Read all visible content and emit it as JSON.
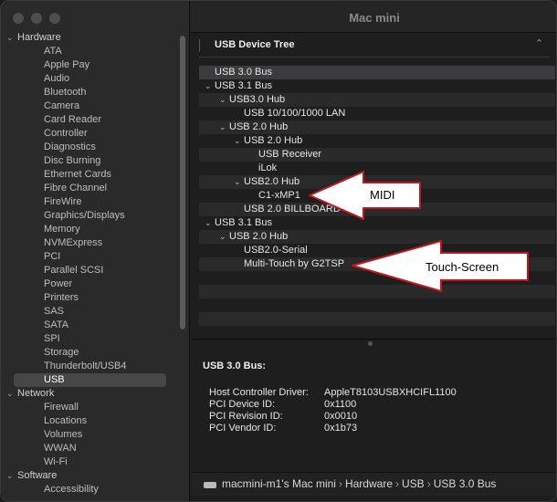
{
  "window": {
    "title": "Mac mini"
  },
  "sidebar": {
    "rows": [
      {
        "kind": "group",
        "label": "Hardware"
      },
      {
        "kind": "item",
        "label": "ATA"
      },
      {
        "kind": "item",
        "label": "Apple Pay"
      },
      {
        "kind": "item",
        "label": "Audio"
      },
      {
        "kind": "item",
        "label": "Bluetooth"
      },
      {
        "kind": "item",
        "label": "Camera"
      },
      {
        "kind": "item",
        "label": "Card Reader"
      },
      {
        "kind": "item",
        "label": "Controller"
      },
      {
        "kind": "item",
        "label": "Diagnostics"
      },
      {
        "kind": "item",
        "label": "Disc Burning"
      },
      {
        "kind": "item",
        "label": "Ethernet Cards"
      },
      {
        "kind": "item",
        "label": "Fibre Channel"
      },
      {
        "kind": "item",
        "label": "FireWire"
      },
      {
        "kind": "item",
        "label": "Graphics/Displays"
      },
      {
        "kind": "item",
        "label": "Memory"
      },
      {
        "kind": "item",
        "label": "NVMExpress"
      },
      {
        "kind": "item",
        "label": "PCI"
      },
      {
        "kind": "item",
        "label": "Parallel SCSI"
      },
      {
        "kind": "item",
        "label": "Power"
      },
      {
        "kind": "item",
        "label": "Printers"
      },
      {
        "kind": "item",
        "label": "SAS"
      },
      {
        "kind": "item",
        "label": "SATA"
      },
      {
        "kind": "item",
        "label": "SPI"
      },
      {
        "kind": "item",
        "label": "Storage"
      },
      {
        "kind": "item",
        "label": "Thunderbolt/USB4"
      },
      {
        "kind": "item",
        "label": "USB",
        "selected": true
      },
      {
        "kind": "group",
        "label": "Network"
      },
      {
        "kind": "item",
        "label": "Firewall"
      },
      {
        "kind": "item",
        "label": "Locations"
      },
      {
        "kind": "item",
        "label": "Volumes"
      },
      {
        "kind": "item",
        "label": "WWAN"
      },
      {
        "kind": "item",
        "label": "Wi-Fi"
      },
      {
        "kind": "group",
        "label": "Software"
      },
      {
        "kind": "item",
        "label": "Accessibility"
      }
    ]
  },
  "tree": {
    "header": "USB Device Tree",
    "rows": [
      {
        "label": "USB 3.0 Bus",
        "level": 0,
        "expandable": false,
        "selected": true
      },
      {
        "label": "USB 3.1 Bus",
        "level": 0,
        "expandable": true
      },
      {
        "label": "USB3.0 Hub",
        "level": 1,
        "expandable": true
      },
      {
        "label": "USB 10/100/1000 LAN",
        "level": 2,
        "expandable": false
      },
      {
        "label": "USB 2.0 Hub",
        "level": 1,
        "expandable": true
      },
      {
        "label": "USB 2.0 Hub",
        "level": 2,
        "expandable": true
      },
      {
        "label": "USB Receiver",
        "level": 3,
        "expandable": false
      },
      {
        "label": "iLok",
        "level": 3,
        "expandable": false
      },
      {
        "label": "USB2.0 Hub",
        "level": 2,
        "expandable": true
      },
      {
        "label": "C1-xMP1",
        "level": 3,
        "expandable": false
      },
      {
        "label": "USB 2.0 BILLBOARD",
        "level": 2,
        "expandable": false
      },
      {
        "label": "USB 3.1 Bus",
        "level": 0,
        "expandable": true
      },
      {
        "label": "USB 2.0 Hub",
        "level": 1,
        "expandable": true
      },
      {
        "label": "USB2.0-Serial",
        "level": 2,
        "expandable": false
      },
      {
        "label": "Multi-Touch by G2TSP",
        "level": 2,
        "expandable": false
      },
      {
        "label": "",
        "level": 0
      },
      {
        "label": "",
        "level": 0
      },
      {
        "label": "",
        "level": 0
      },
      {
        "label": "",
        "level": 0
      },
      {
        "label": "",
        "level": 0
      }
    ]
  },
  "details": {
    "title": "USB 3.0 Bus:",
    "fields": [
      {
        "key": "Host Controller Driver:",
        "value": "AppleT8103USBXHCIFL1100"
      },
      {
        "key": "PCI Device ID:",
        "value": "0x1100"
      },
      {
        "key": "PCI Revision ID:",
        "value": "0x0010"
      },
      {
        "key": "PCI Vendor ID:",
        "value": "0x1b73"
      }
    ]
  },
  "pathbar": {
    "crumbs": [
      "macmini-m1's Mac mini",
      "Hardware",
      "USB",
      "USB 3.0 Bus"
    ],
    "separator": "›"
  },
  "annotations": {
    "midi": "MIDI",
    "touch": "Touch-Screen",
    "arrow_fill": "#ffffff",
    "arrow_stroke": "#c4161c"
  }
}
